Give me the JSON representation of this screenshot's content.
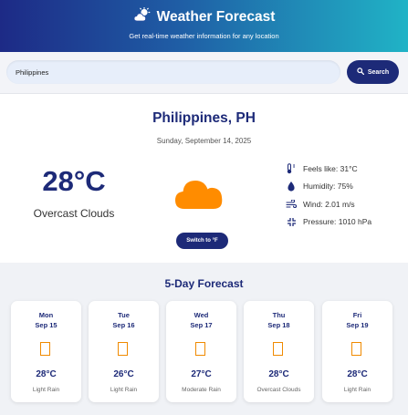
{
  "header": {
    "title": "Weather Forecast",
    "subtitle": "Get real-time weather information for any location"
  },
  "search": {
    "value": "Philippines",
    "button_label": "Search"
  },
  "current": {
    "location": "Philippines, PH",
    "date": "Sunday, September 14, 2025",
    "temperature": "28°C",
    "condition": "Overcast Clouds",
    "unit_toggle_label": "Switch to °F",
    "details": {
      "feels_like": "Feels like: 31°C",
      "humidity": "Humidity: 75%",
      "wind": "Wind: 2.01 m/s",
      "pressure": "Pressure: 1010 hPa"
    }
  },
  "forecast": {
    "title": "5-Day Forecast",
    "days": [
      {
        "day": "Mon",
        "date": "Sep 15",
        "temp": "28°C",
        "desc": "Light Rain"
      },
      {
        "day": "Tue",
        "date": "Sep 16",
        "temp": "26°C",
        "desc": "Light Rain"
      },
      {
        "day": "Wed",
        "date": "Sep 17",
        "temp": "27°C",
        "desc": "Moderate Rain"
      },
      {
        "day": "Thu",
        "date": "Sep 18",
        "temp": "28°C",
        "desc": "Overcast Clouds"
      },
      {
        "day": "Fri",
        "date": "Sep 19",
        "temp": "28°C",
        "desc": "Light Rain"
      }
    ]
  },
  "colors": {
    "primary": "#1d2a78",
    "accent": "#ff8c00",
    "header_gradient_start": "#1d2a86",
    "header_gradient_end": "#20b3c6"
  },
  "icons": {
    "header": "cloud-sun-icon",
    "search": "search-icon",
    "current": "cloud-icon",
    "feels_like": "thermometer-icon",
    "humidity": "droplet-icon",
    "wind": "wind-icon",
    "pressure": "compress-icon",
    "forecast_day": "missing-glyph-icon"
  }
}
